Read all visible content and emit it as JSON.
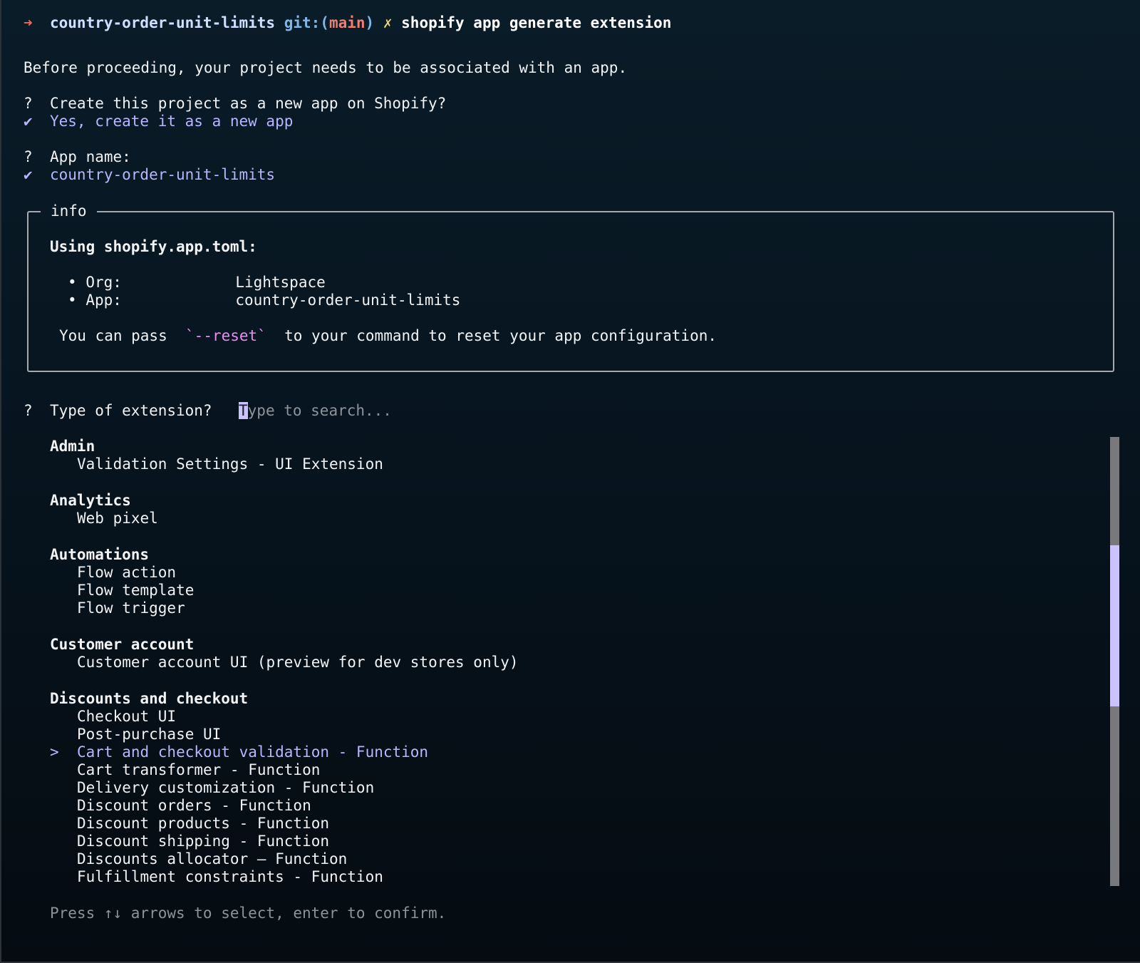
{
  "prompt": {
    "arrow": "➜",
    "directory": "country-order-unit-limits",
    "git_label": "git:(",
    "branch": "main",
    "git_close": ")",
    "dirty_marker": "✗",
    "command": "shopify app generate extension"
  },
  "intro": "Before proceeding, your project needs to be associated with an app.",
  "questions": [
    {
      "mark": "?",
      "text": "Create this project as a new app on Shopify?",
      "check": "✔",
      "answer": "Yes, create it as a new app"
    },
    {
      "mark": "?",
      "text": "App name:",
      "check": "✔",
      "answer": "country-order-unit-limits"
    }
  ],
  "info_box": {
    "title": "info",
    "heading": "Using shopify.app.toml:",
    "rows": [
      {
        "bullet": "•",
        "key": "Org:",
        "value": "Lightspace"
      },
      {
        "bullet": "•",
        "key": "App:",
        "value": "country-order-unit-limits"
      }
    ],
    "note_before": "You can pass ",
    "note_code": "`--reset`",
    "note_after": " to your command to reset your app configuration."
  },
  "extension_prompt": {
    "mark": "?",
    "question": "Type of extension?",
    "placeholder_first": "T",
    "placeholder_rest": "ype to search..."
  },
  "groups": [
    {
      "label": "Admin",
      "items": [
        "Validation Settings - UI Extension"
      ]
    },
    {
      "label": "Analytics",
      "items": [
        "Web pixel"
      ]
    },
    {
      "label": "Automations",
      "items": [
        "Flow action",
        "Flow template",
        "Flow trigger"
      ]
    },
    {
      "label": "Customer account",
      "items": [
        "Customer account UI (preview for dev stores only)"
      ]
    },
    {
      "label": "Discounts and checkout",
      "items": [
        "Checkout UI",
        "Post-purchase UI",
        "Cart and checkout validation - Function",
        "Cart transformer - Function",
        "Delivery customization - Function",
        "Discount orders - Function",
        "Discount products - Function",
        "Discount shipping - Function",
        "Discounts allocator — Function",
        "Fulfillment constraints - Function"
      ]
    }
  ],
  "selected_marker": ">",
  "selected_item": "Cart and checkout validation - Function",
  "footer": "Press ↑↓ arrows to select, enter to confirm.",
  "colors": {
    "background": "#071520",
    "selected": "#b9b6ff",
    "branch": "#ef7e6e",
    "code": "#e88df0",
    "scroll_thumb": "#c9c3ff"
  }
}
